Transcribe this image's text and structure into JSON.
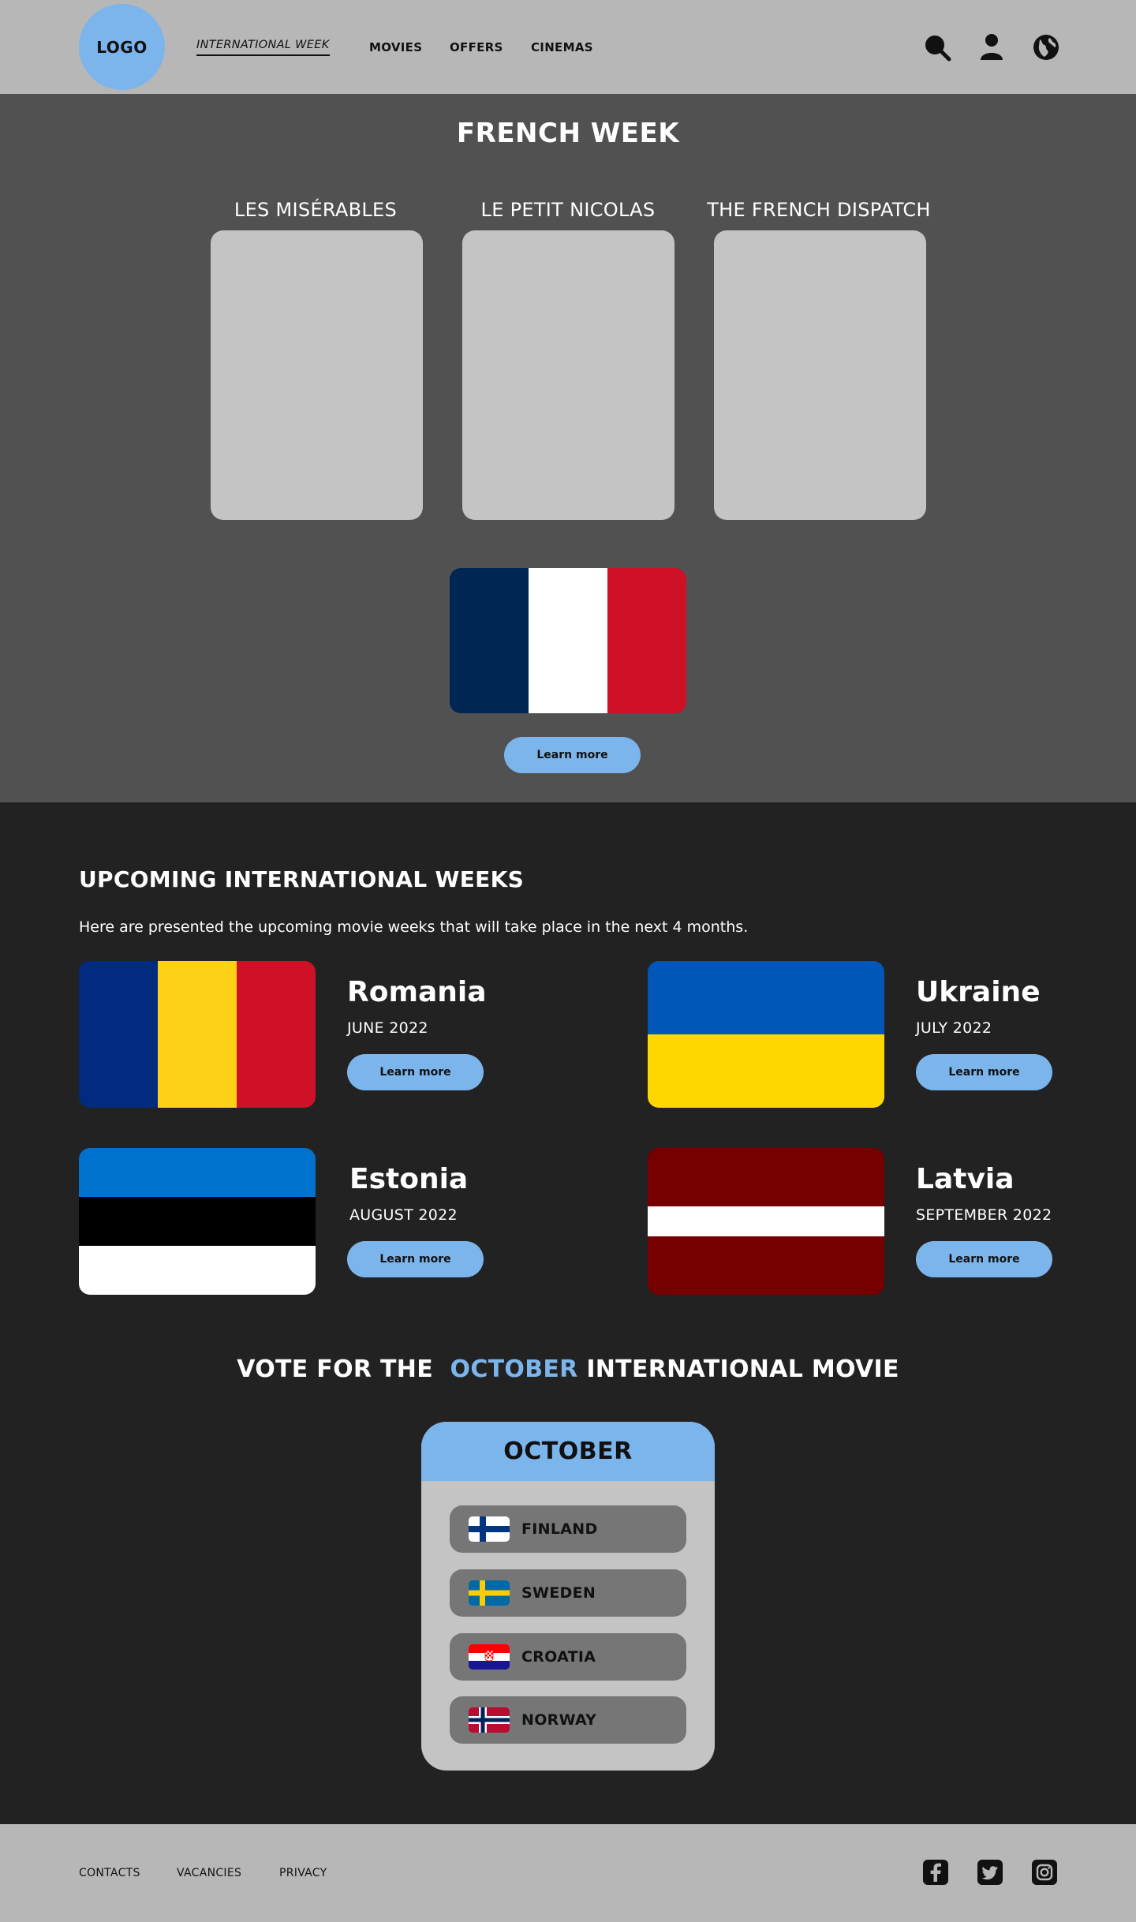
{
  "header": {
    "logo": "LOGO",
    "nav": [
      "INTERNATIONAL WEEK",
      "MOVIES",
      "OFFERS",
      "CINEMAS"
    ],
    "icons": [
      "search-icon",
      "user-icon",
      "globe-icon"
    ]
  },
  "french_week": {
    "title": "FRENCH WEEK",
    "movies": [
      "LES MISÉRABLES",
      "LE PETIT NICOLAS",
      "THE FRENCH DISPATCH"
    ],
    "flag_colors": [
      "#002654",
      "#ffffff",
      "#ce1126"
    ],
    "button": "Learn more"
  },
  "upcoming": {
    "title": "UPCOMING INTERNATIONAL WEEKS",
    "description": "Here are presented the upcoming movie weeks that will take place in the next 4 months.",
    "items": [
      {
        "country": "Romania",
        "date": "JUNE 2022",
        "button": "Learn more"
      },
      {
        "country": "Ukraine",
        "date": "JULY 2022",
        "button": "Learn more"
      },
      {
        "country": "Estonia",
        "date": "AUGUST 2022",
        "button": "Learn more"
      },
      {
        "country": "Latvia",
        "date": "SEPTEMBER 2022",
        "button": "Learn more"
      }
    ]
  },
  "vote": {
    "title_pre": "VOTE FOR THE",
    "title_month": "OCTOBER",
    "title_post": "INTERNATIONAL MOVIE",
    "card_title": "OCTOBER",
    "options": [
      "FINLAND",
      "SWEDEN",
      "CROATIA",
      "NORWAY"
    ]
  },
  "footer": {
    "links": [
      "CONTACTS",
      "VACANCIES",
      "PRIVACY"
    ],
    "social": [
      "facebook-icon",
      "twitter-icon",
      "instagram-icon"
    ]
  },
  "colors": {
    "accent": "#7cb5ec",
    "header_bg": "#b7b7b7",
    "hero_bg": "#515151",
    "body_bg": "#222222",
    "card_bg": "#c4c4c4"
  }
}
